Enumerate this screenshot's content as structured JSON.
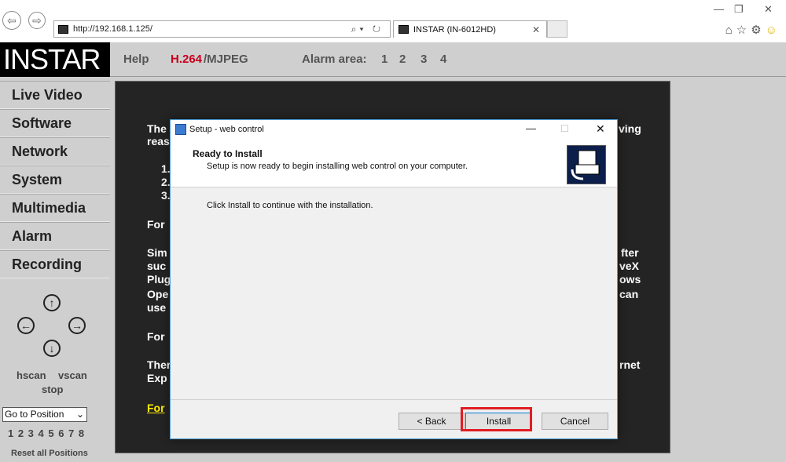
{
  "browser": {
    "url": "http://192.168.1.125/",
    "tab_title": "INSTAR (IN-6012HD)",
    "search_icon": "search-icon",
    "refresh_icon": "refresh-icon"
  },
  "header": {
    "logo": "INSTAR",
    "help": "Help",
    "codec_h264": "H.264",
    "codec_mjpeg": "/MJPEG",
    "alarm_label": "Alarm area:",
    "alarm_areas": [
      "1",
      "2",
      "3",
      "4"
    ]
  },
  "sidebar": {
    "items": [
      "Live Video",
      "Software",
      "Network",
      "System",
      "Multimedia",
      "Alarm",
      "Recording"
    ],
    "hscan": "hscan",
    "vscan": "vscan",
    "stop": "stop",
    "goto_selected": "Go to Position",
    "positions": "1 2 3 4 5 6 7 8",
    "reset": "Reset all Positions"
  },
  "video_bg_text": {
    "line1": "The",
    "line1_right": "ving",
    "line2": "reas",
    "n1": "1.",
    "n2": "2.",
    "n3": "3.",
    "for1": "For",
    "sim": "Sim",
    "sim_right": "fter",
    "suc": "suc",
    "suc_right": "veX",
    "plug": "Plug",
    "plug_right": "ows",
    "ope": "Ope",
    "ope_right": "can",
    "use": "use",
    "for2": "For",
    "ther": "Ther",
    "ther_right": "rnet",
    "exp": "Exp",
    "for3": "For"
  },
  "dialog": {
    "title": "Setup - web control",
    "heading": "Ready to Install",
    "subheading": "Setup is now ready to begin installing web control on your computer.",
    "body": "Click Install to continue with the installation.",
    "back_button": "< Back",
    "install_button": "Install",
    "cancel_button": "Cancel",
    "highlight_color": "#e11d24"
  }
}
